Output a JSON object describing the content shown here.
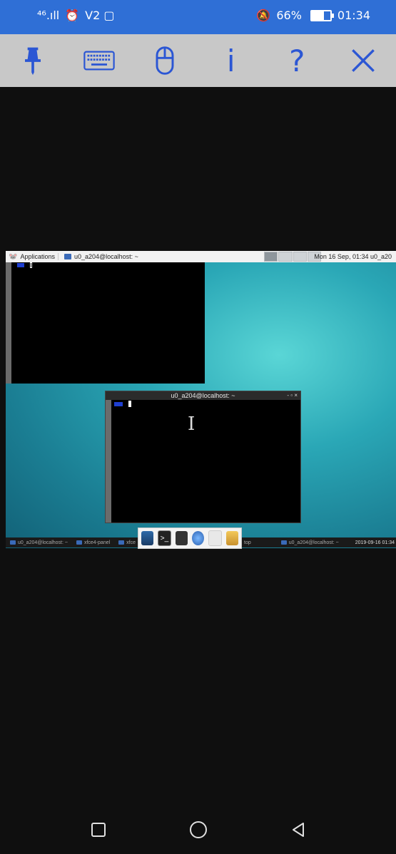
{
  "status": {
    "signal": "⁴⁶.ıll",
    "alarm": "⏰",
    "extra": "V2 ▢",
    "mute": "🔕",
    "battery_percent": "66%",
    "battery_level": 0.66,
    "time": "01:34"
  },
  "toolbar": {
    "pin_icon": "pin-icon",
    "keyboard_icon": "keyboard-icon",
    "mouse_icon": "mouse-icon",
    "info_label": "i",
    "help_label": "?",
    "close_icon": "close-icon"
  },
  "desktop": {
    "top_panel": {
      "applications": "Applications",
      "task_title": "u0_a204@localhost: ~",
      "clock": "Mon 16 Sep, 01:34  u0_a20"
    },
    "terminal_window": {
      "title": "u0_a204@localhost: ~",
      "controls": "- ▫ ×"
    },
    "taskbar": {
      "item1": "u0_a204@localhost: ~",
      "item2": "xfce4-panel",
      "item3": "xfce",
      "item4": "top",
      "item5": "u0_a204@localhost: ~",
      "clock": "2019-09-16 01:34"
    }
  },
  "nav": {
    "recent_icon": "square-icon",
    "home_icon": "circle-icon",
    "back_icon": "triangle-icon"
  }
}
